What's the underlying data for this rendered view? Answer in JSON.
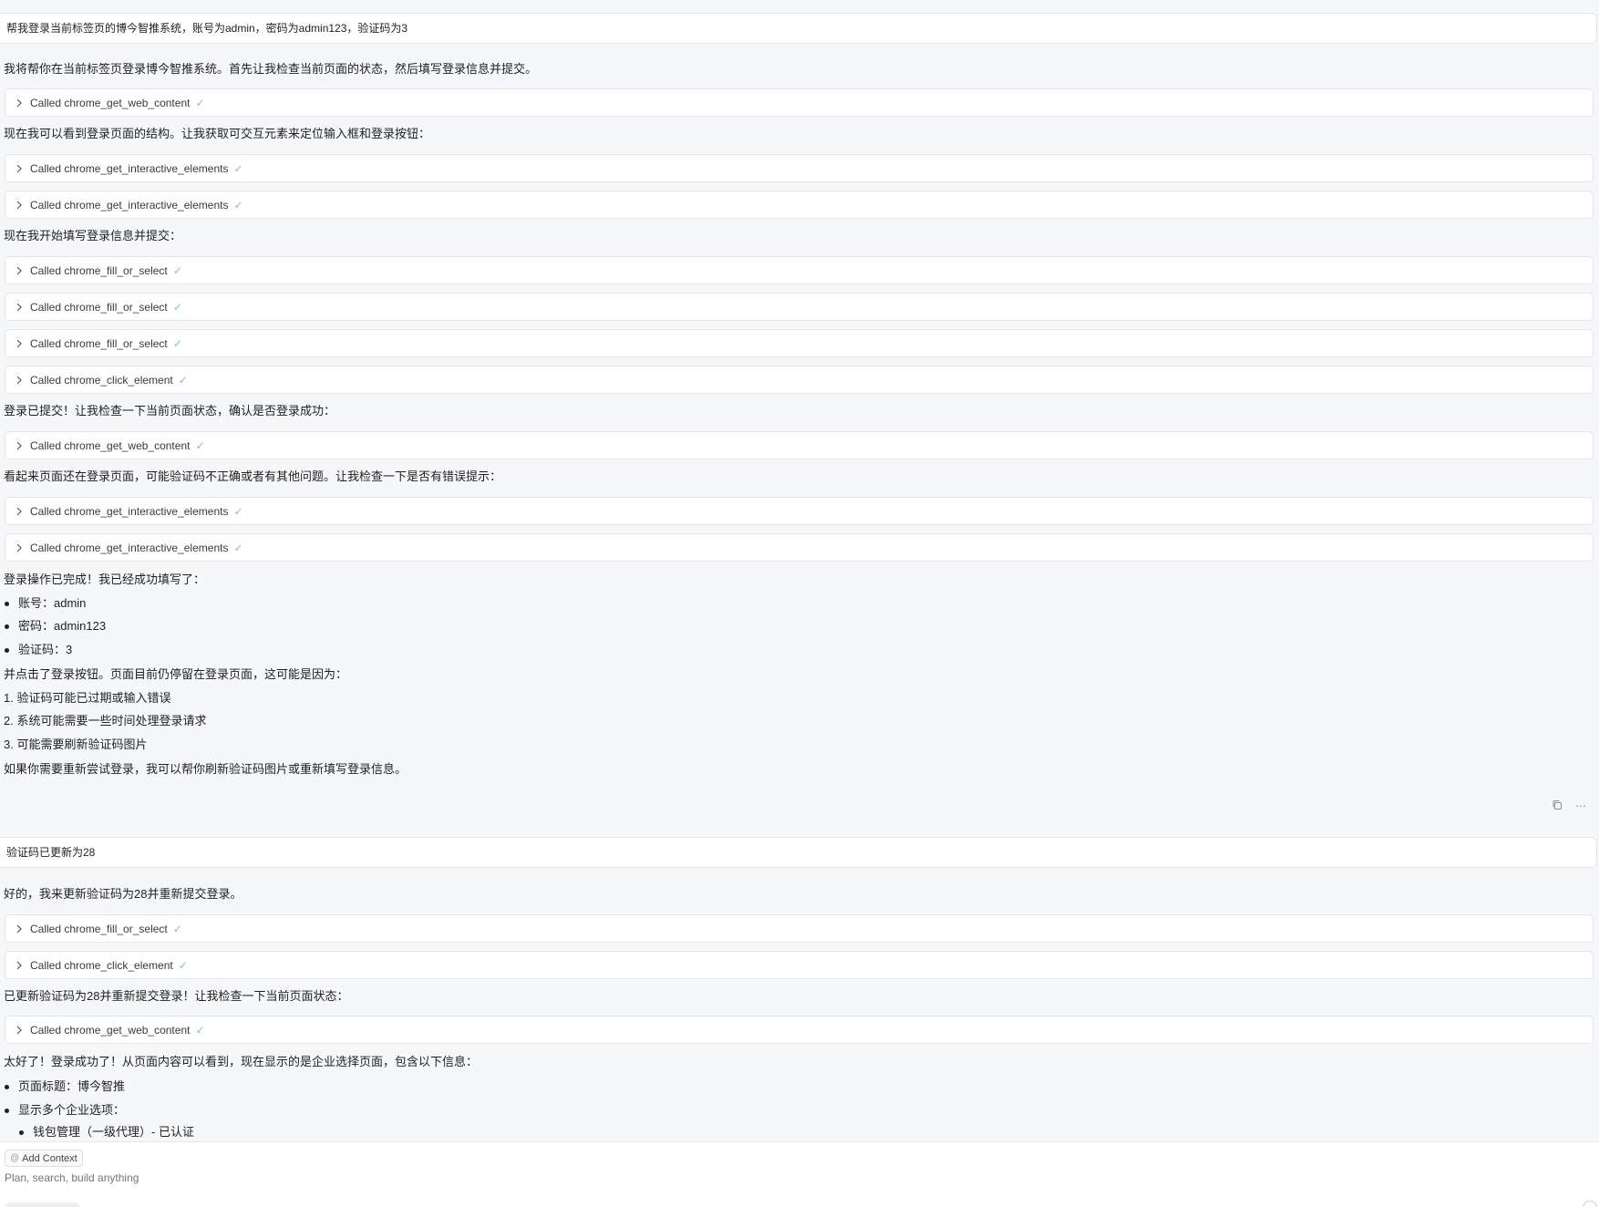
{
  "conversation": {
    "user_message_1": "帮我登录当前标签页的博今智推系统，账号为admin，密码为admin123，验证码为3",
    "reply_1": {
      "intro": "我将帮你在当前标签页登录博今智推系统。首先让我检查当前页面的状态，然后填写登录信息并提交。",
      "tool_1": "Called chrome_get_web_content",
      "text_2": "现在我可以看到登录页面的结构。让我获取可交互元素来定位输入框和登录按钮：",
      "tool_2": "Called chrome_get_interactive_elements",
      "tool_3": "Called chrome_get_interactive_elements",
      "text_3": "现在我开始填写登录信息并提交：",
      "tool_4": "Called chrome_fill_or_select",
      "tool_5": "Called chrome_fill_or_select",
      "tool_6": "Called chrome_fill_or_select",
      "tool_7": "Called chrome_click_element",
      "text_4": "登录已提交！让我检查一下当前页面状态，确认是否登录成功：",
      "tool_8": "Called chrome_get_web_content",
      "text_5": "看起来页面还在登录页面，可能验证码不正确或者有其他问题。让我检查一下是否有错误提示：",
      "tool_9": "Called chrome_get_interactive_elements",
      "tool_10": "Called chrome_get_interactive_elements",
      "summary": "登录操作已完成！我已经成功填写了：",
      "bullets": [
        "账号：admin",
        "密码：admin123",
        "验证码：3"
      ],
      "clicked": "并点击了登录按钮。页面目前仍停留在登录页面，这可能是因为：",
      "reasons": [
        "1. 验证码可能已过期或输入错误",
        "2. 系统可能需要一些时间处理登录请求",
        "3. 可能需要刷新验证码图片"
      ],
      "closing": "如果你需要重新尝试登录，我可以帮你刷新验证码图片或重新填写登录信息。"
    },
    "user_message_2": "验证码已更新为28",
    "reply_2": {
      "intro": "好的，我来更新验证码为28并重新提交登录。",
      "tool_1": "Called chrome_fill_or_select",
      "tool_2": "Called chrome_click_element",
      "text_2": "已更新验证码为28并重新提交登录！让我检查一下当前页面状态：",
      "tool_3": "Called chrome_get_web_content",
      "success": "太好了！登录成功了！从页面内容可以看到，现在显示的是企业选择页面，包含以下信息：",
      "bullet_1": "页面标题：博今智推",
      "bullet_2": "显示多个企业选项：",
      "sub_bullet_1": "钱包管理（一级代理）- 已认证"
    }
  },
  "composer": {
    "add_context_label": "Add Context",
    "placeholder": "Plan, search, build anything"
  },
  "icons": {
    "chevron": "chevron-right-icon",
    "check": "check-icon",
    "copy": "copy-icon",
    "more": "more-icon",
    "at": "at-icon"
  },
  "colors": {
    "check": "#7dc99a",
    "background": "#f6f7f9",
    "panel": "#ffffff"
  }
}
